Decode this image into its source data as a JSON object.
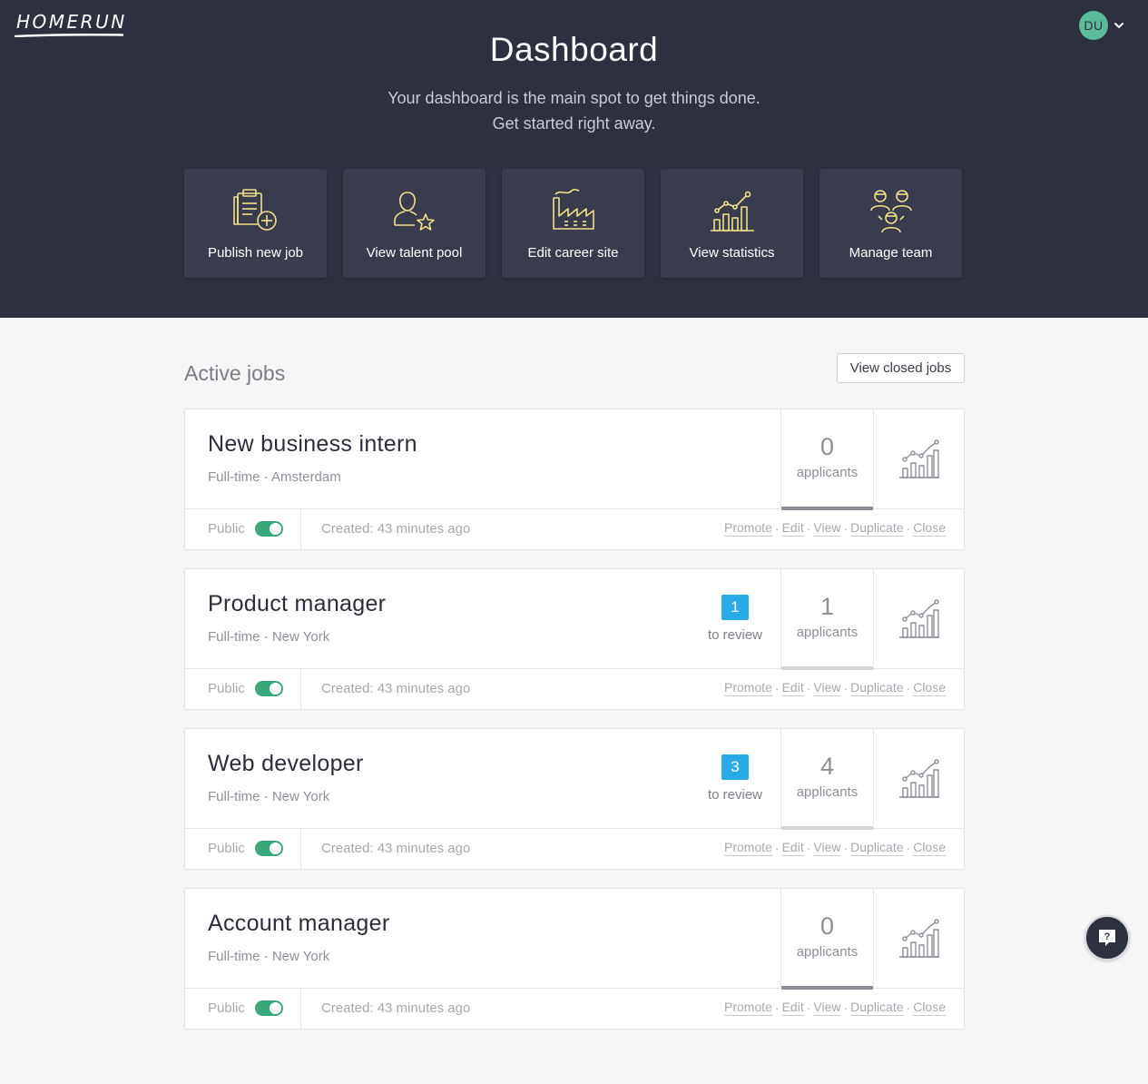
{
  "header": {
    "logo": "HOMERUN",
    "user_initials": "DU",
    "title": "Dashboard",
    "subtitle_line1": "Your dashboard is the main spot to get things done.",
    "subtitle_line2": "Get started right away."
  },
  "quick_actions": [
    {
      "label": "Publish new job",
      "icon": "clipboard-plus-icon"
    },
    {
      "label": "View talent pool",
      "icon": "user-star-icon"
    },
    {
      "label": "Edit career site",
      "icon": "factory-icon"
    },
    {
      "label": "View statistics",
      "icon": "chart-icon"
    },
    {
      "label": "Manage team",
      "icon": "team-icon"
    }
  ],
  "active_jobs": {
    "title": "Active jobs",
    "closed_button": "View closed jobs",
    "jobs": [
      {
        "title": "New business intern",
        "meta": "Full-time · Amsterdam",
        "to_review": null,
        "to_review_label": "",
        "applicants": "0",
        "applicants_label": "applicants",
        "visibility": "Public",
        "public_on": true,
        "created": "Created: 43 minutes ago"
      },
      {
        "title": "Product manager",
        "meta": "Full-time · New York",
        "to_review": "1",
        "to_review_label": "to review",
        "applicants": "1",
        "applicants_label": "applicants",
        "visibility": "Public",
        "public_on": true,
        "created": "Created: 43 minutes ago"
      },
      {
        "title": "Web developer",
        "meta": "Full-time · New York",
        "to_review": "3",
        "to_review_label": "to review",
        "applicants": "4",
        "applicants_label": "applicants",
        "visibility": "Public",
        "public_on": true,
        "created": "Created: 43 minutes ago"
      },
      {
        "title": "Account manager",
        "meta": "Full-time · New York",
        "to_review": null,
        "to_review_label": "",
        "applicants": "0",
        "applicants_label": "applicants",
        "visibility": "Public",
        "public_on": true,
        "created": "Created: 43 minutes ago"
      }
    ],
    "actions": {
      "promote": "Promote",
      "edit": "Edit",
      "view": "View",
      "duplicate": "Duplicate",
      "close": "Close",
      "separator": "·"
    }
  },
  "help": {
    "icon": "help-chat-icon",
    "glyph": "?"
  },
  "colors": {
    "hero_bg": "#2d303e",
    "card_bg": "#393c4c",
    "icon_yellow": "#f3e08c",
    "toggle_green": "#3aa67c",
    "review_blue": "#29a9e6"
  }
}
